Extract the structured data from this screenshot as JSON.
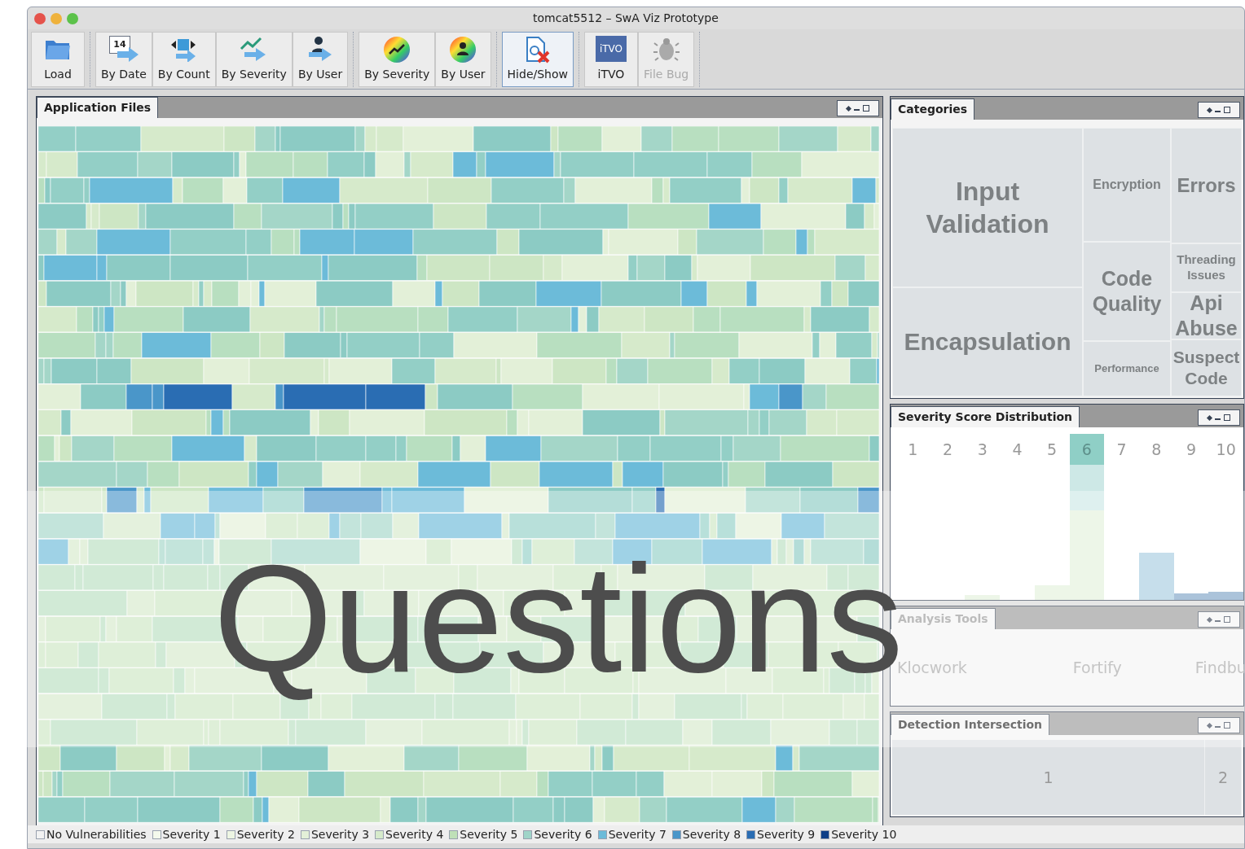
{
  "window": {
    "title": "tomcat5512 – SwA Viz Prototype"
  },
  "toolbar": {
    "groups": [
      [
        {
          "label": "Load",
          "kind": "folder",
          "selected": false,
          "disabled": false
        }
      ],
      [
        {
          "label": "By Date",
          "kind": "calendar",
          "icon_text": "14",
          "selected": false,
          "disabled": false
        },
        {
          "label": "By Count",
          "kind": "resize",
          "selected": false,
          "disabled": false
        },
        {
          "label": "By Severity",
          "kind": "trend",
          "selected": false,
          "disabled": false
        },
        {
          "label": "By User",
          "kind": "person",
          "selected": false,
          "disabled": false
        }
      ],
      [
        {
          "label": "By Severity",
          "kind": "color-trend",
          "selected": false,
          "disabled": false
        },
        {
          "label": "By User",
          "kind": "color-person",
          "selected": false,
          "disabled": false
        }
      ],
      [
        {
          "label": "Hide/Show",
          "kind": "doc-x",
          "selected": true,
          "disabled": false
        }
      ],
      [
        {
          "label": "iTVO",
          "kind": "logo",
          "icon_text": "iTVO",
          "selected": false,
          "disabled": false
        },
        {
          "label": "File Bug",
          "kind": "bug",
          "selected": false,
          "disabled": true
        }
      ]
    ]
  },
  "application_files": {
    "title": "Application Files"
  },
  "categories": {
    "title": "Categories",
    "cells": [
      {
        "label": "Input Validation"
      },
      {
        "label": "Encapsulation"
      },
      {
        "label": "Encryption"
      },
      {
        "label": "Code Quality"
      },
      {
        "label": "Performance"
      },
      {
        "label": "Errors"
      },
      {
        "label": "Threading Issues"
      },
      {
        "label": "Api Abuse"
      },
      {
        "label": "Suspect Code"
      }
    ]
  },
  "severity_distribution": {
    "title": "Severity Score Distribution",
    "columns": [
      {
        "label": "1",
        "selected": false
      },
      {
        "label": "2",
        "selected": false
      },
      {
        "label": "3",
        "selected": false
      },
      {
        "label": "4",
        "selected": false
      },
      {
        "label": "5",
        "selected": false
      },
      {
        "label": "6",
        "selected": true
      },
      {
        "label": "7",
        "selected": false
      },
      {
        "label": "8",
        "selected": false
      },
      {
        "label": "9",
        "selected": false
      },
      {
        "label": "10",
        "selected": false
      }
    ]
  },
  "analysis_tools": {
    "title": "Analysis Tools",
    "tools": [
      "Klocwork",
      "Fortify",
      "Findbu"
    ]
  },
  "detection_intersection": {
    "title": "Detection Intersection",
    "cells": [
      "1",
      "2"
    ]
  },
  "legend": [
    {
      "label": "No Vulnerabilities",
      "color": "#f2f2f2"
    },
    {
      "label": "Severity 1",
      "color": "#f4f9ec"
    },
    {
      "label": "Severity 2",
      "color": "#edf5e3"
    },
    {
      "label": "Severity 3",
      "color": "#e3f0d8"
    },
    {
      "label": "Severity 4",
      "color": "#d6eacb"
    },
    {
      "label": "Severity 5",
      "color": "#bfe0b8"
    },
    {
      "label": "Severity 6",
      "color": "#9fd4c8"
    },
    {
      "label": "Severity 7",
      "color": "#6cbbd9"
    },
    {
      "label": "Severity 8",
      "color": "#4a96c9"
    },
    {
      "label": "Severity 9",
      "color": "#2a6db3"
    },
    {
      "label": "Severity 10",
      "color": "#0d3e87"
    }
  ],
  "overlay": {
    "text": "Questions"
  }
}
